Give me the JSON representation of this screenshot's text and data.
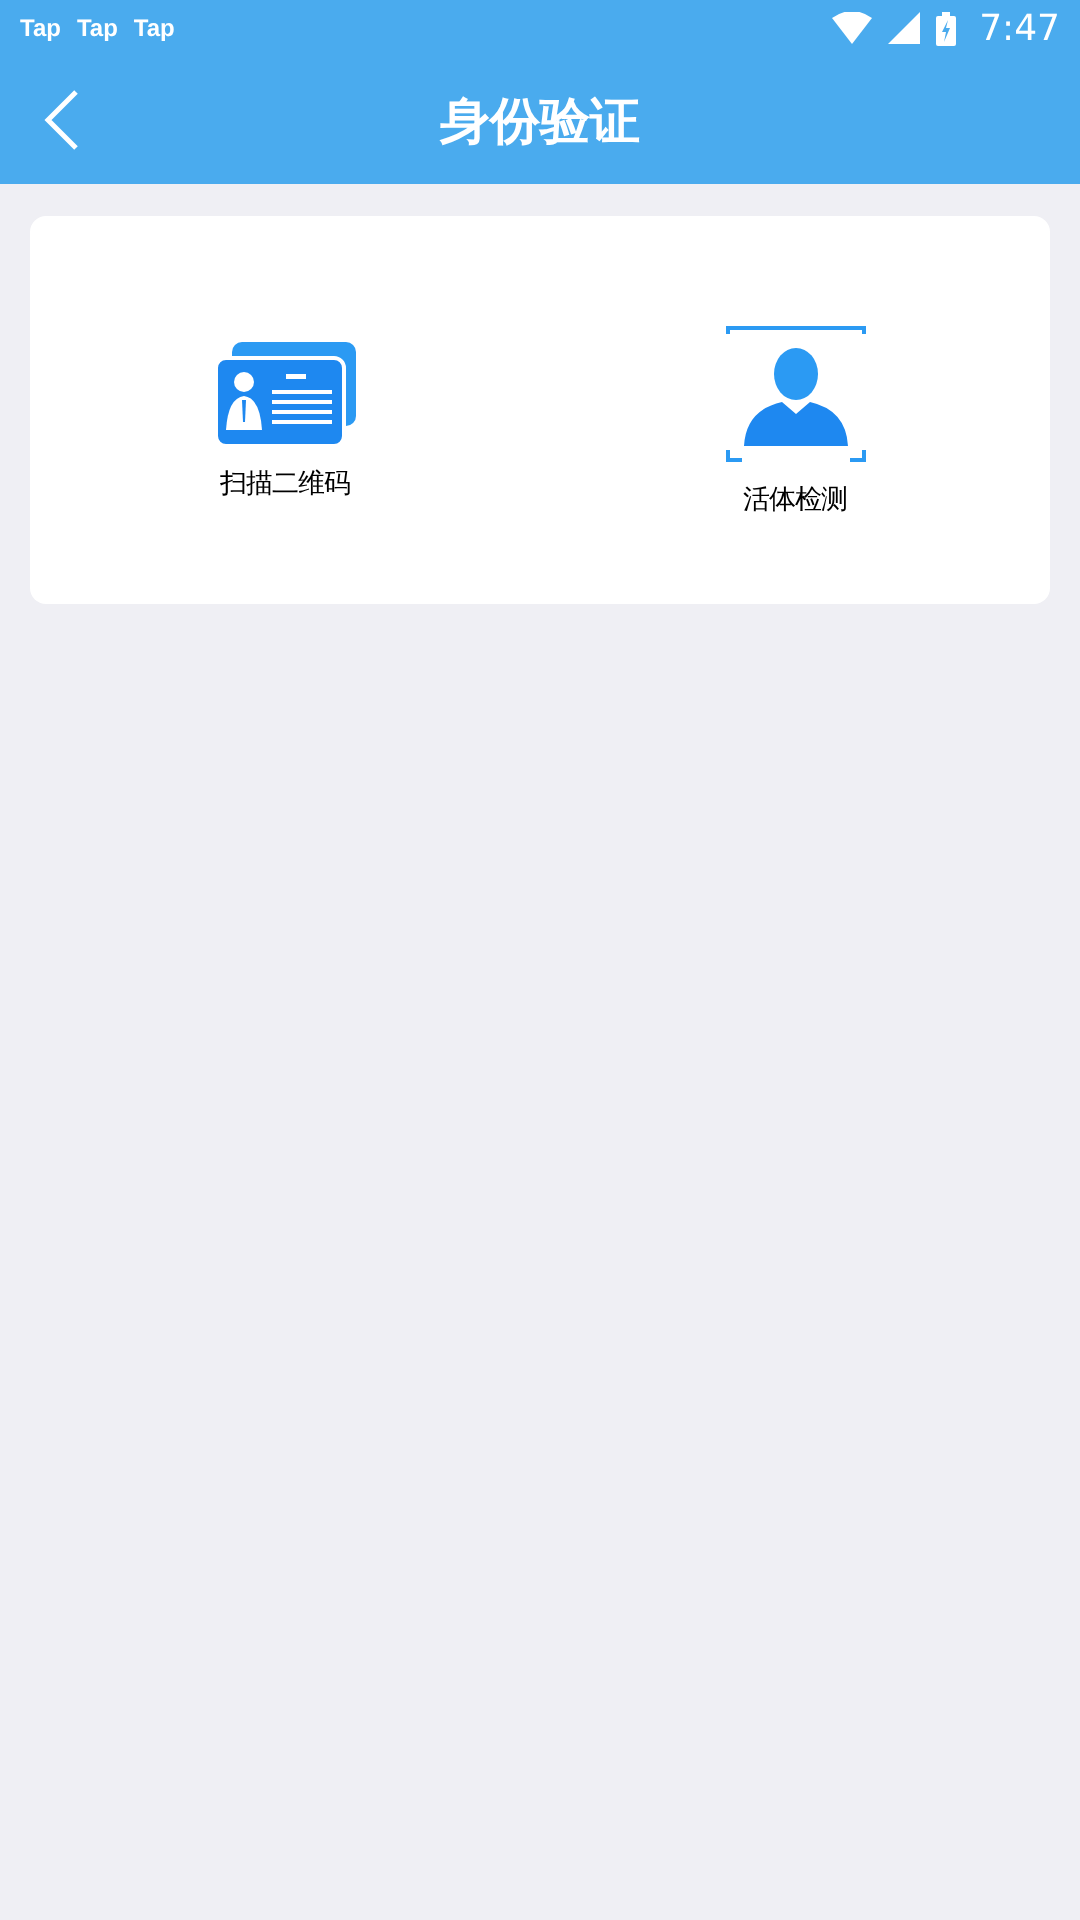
{
  "status_bar": {
    "apps": [
      "Tap",
      "Tap",
      "Tap"
    ],
    "time": "7:47"
  },
  "header": {
    "title": "身份验证"
  },
  "options": [
    {
      "kind": "id-card",
      "label": "扫描二维码"
    },
    {
      "kind": "face-scan",
      "label": "活体检测"
    }
  ]
}
